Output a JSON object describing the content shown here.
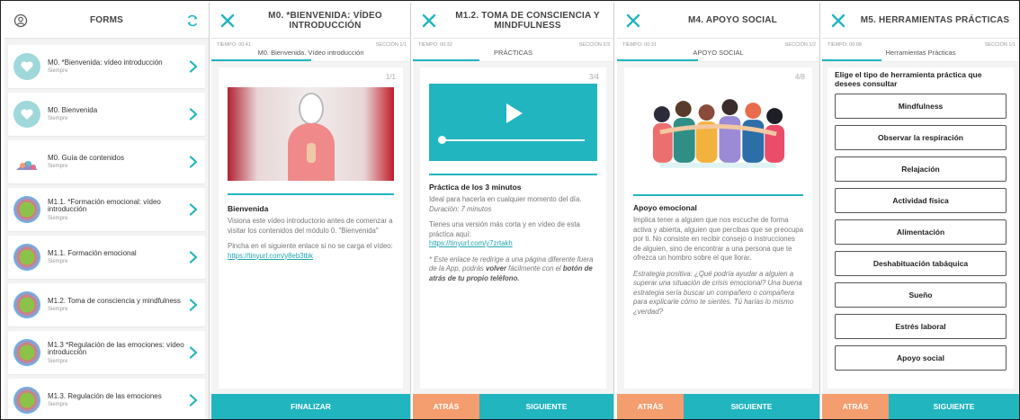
{
  "screen1": {
    "title": "FORMS",
    "items": [
      {
        "name": "M0. *Bienvenida: vídeo introducción",
        "sub": "Siempre",
        "thumb": "heart"
      },
      {
        "name": "M0. Bienvenida",
        "sub": "Siempre",
        "thumb": "heart"
      },
      {
        "name": "M0. Guía de contenidos",
        "sub": "Siempre",
        "thumb": "pile"
      },
      {
        "name": "M1.1. *Formación emocional: vídeo introducción",
        "sub": "Siempre",
        "thumb": "globe"
      },
      {
        "name": "M1.1. Formación emocional",
        "sub": "Siempre",
        "thumb": "globe"
      },
      {
        "name": "M1.2. Toma de consciencia y mindfulness",
        "sub": "Siempre",
        "thumb": "globe"
      },
      {
        "name": "M1.3 *Regulación de las emociones: vídeo introducción",
        "sub": "Siempre",
        "thumb": "globe"
      },
      {
        "name": "M1.3. Regulación de las emociones",
        "sub": "Siempre",
        "thumb": "globe"
      }
    ]
  },
  "screen2": {
    "title": "M0. *BIENVENIDA: VÍDEO INTRODUCCIÓN",
    "time": "TIEMPO: 00:41",
    "section": "SECCIÓN 1/1",
    "subtitle": "M0. Bienvenida. Vídeo introducción",
    "page": "1/1",
    "heading": "Bienvenida",
    "p1": "Visiona este vídeo introductorio antes de comenzar a visitar los contenidos del módulo 0. \"Bienvenida\"",
    "p2": "Pincha en el siguiente enlace si no se carga el vídeo:",
    "link": "https://tinyurl.com/y8eb3tbk",
    "finish": "FINALIZAR",
    "progress": 0.5
  },
  "screen3": {
    "title": "M1.2. TOMA DE CONSCIENCIA Y MINDFULNESS",
    "time": "TIEMPO: 00:32",
    "section": "SECCIÓN 2/3",
    "subtitle": "PRÁCTICAS",
    "page": "3/4",
    "heading": "Práctica de los 3 minutos",
    "p1": "Ideal para hacerla en cualquier momento del día.",
    "p1b": "Duración: 7 minutos",
    "p2": "Tienes una versión más corta y en vídeo de esta práctica aquí:",
    "link": "https://tinyurl.com/y7zrtakh",
    "note_a": "* Este enlace te redirige a una página diferente fuera de la App, podrás ",
    "note_b": "volver",
    "note_c": " fácilmente con el ",
    "note_d": "botón de atrás de tu propio teléfono.",
    "back": "ATRÁS",
    "next": "SIGUIENTE",
    "progress": 0.33
  },
  "screen4": {
    "title": "M4. APOYO SOCIAL",
    "time": "TIEMPO: 00:31",
    "section": "SECCIÓN 1/2",
    "subtitle": "APOYO SOCIAL",
    "page": "4/8",
    "heading": "Apoyo emocional",
    "p1": "Implica tener a alguien que nos escuche de forma activa y abierta, alguien que percibas que se preocupa por ti. No consiste en recibir consejo o instrucciones de alguien, sino de encontrar a una persona que te ofrezca un hombro sobre el que llorar.",
    "p2a": "Estrategia positiva",
    "p2b": ": ¿Qué podría ayudar a alguien  a superar una situación de crisis emocional? Una buena estrategia sería buscar un compañero o compañera para explicarle cómo te sientes. Tú harías lo mismo ¿verdad?",
    "back": "ATRÁS",
    "next": "SIGUIENTE",
    "progress": 0.4
  },
  "screen5": {
    "title": "M5. HERRAMIENTAS PRÁCTICAS",
    "time": "TIEMPO: 00:08",
    "section": "SECCIÓN 1/1",
    "subtitle": "Herramientas Prácticas",
    "prompt": "Elige el tipo de herramienta práctica que desees consultar",
    "tools": [
      "Mindfulness",
      "Observar la respiración",
      "Relajación",
      "Actividad física",
      "Alimentación",
      "Deshabituación tabáquica",
      "Sueño",
      "Estrés laboral",
      "Apoyo social"
    ],
    "back": "ATRÁS",
    "next": "SIGUIENTE",
    "progress": 0.3
  },
  "colors": {
    "teal": "#21b5bf",
    "orange": "#f49d6e"
  }
}
